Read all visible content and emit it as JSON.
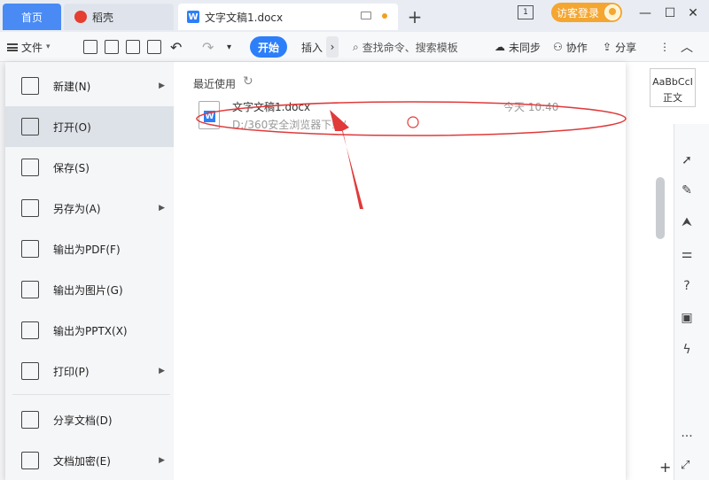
{
  "titlebar": {
    "tab_home": "首页",
    "tab_daoke": "稻壳",
    "tab_doc": "文字文稿1.docx",
    "add_tab": "+",
    "login_button": "访客登录",
    "page_indicator": "1"
  },
  "toolbar": {
    "file_label": "文件",
    "start_tab": "开始",
    "insert_tab": "插入",
    "search_placeholder": "查找命令、搜索模板",
    "sync_label": "未同步",
    "collab_label": "协作",
    "share_label": "分享"
  },
  "file_menu": {
    "items": [
      {
        "label": "新建(N)",
        "icon": "new-icon"
      },
      {
        "label": "打开(O)",
        "icon": "folder-open-icon"
      },
      {
        "label": "保存(S)",
        "icon": "save-icon"
      },
      {
        "label": "另存为(A)",
        "icon": "save-as-icon"
      },
      {
        "label": "输出为PDF(F)",
        "icon": "pdf-icon"
      },
      {
        "label": "输出为图片(G)",
        "icon": "image-icon"
      },
      {
        "label": "输出为PPTX(X)",
        "icon": "pptx-icon"
      },
      {
        "label": "打印(P)",
        "icon": "print-icon"
      },
      {
        "label": "分享文档(D)",
        "icon": "share-doc-icon"
      },
      {
        "label": "文档加密(E)",
        "icon": "encrypt-icon"
      }
    ],
    "recent_title": "最近使用",
    "recent": {
      "name": "文字文稿1.docx",
      "path": "D:/360安全浏览器下载/",
      "time": "今天 10:40"
    }
  },
  "style_panel": {
    "sample": "AaBbCcI",
    "name": "正文"
  },
  "colors": {
    "accent": "#2d7ff9",
    "login": "#f4a630",
    "annotation": "#e03a3a"
  }
}
